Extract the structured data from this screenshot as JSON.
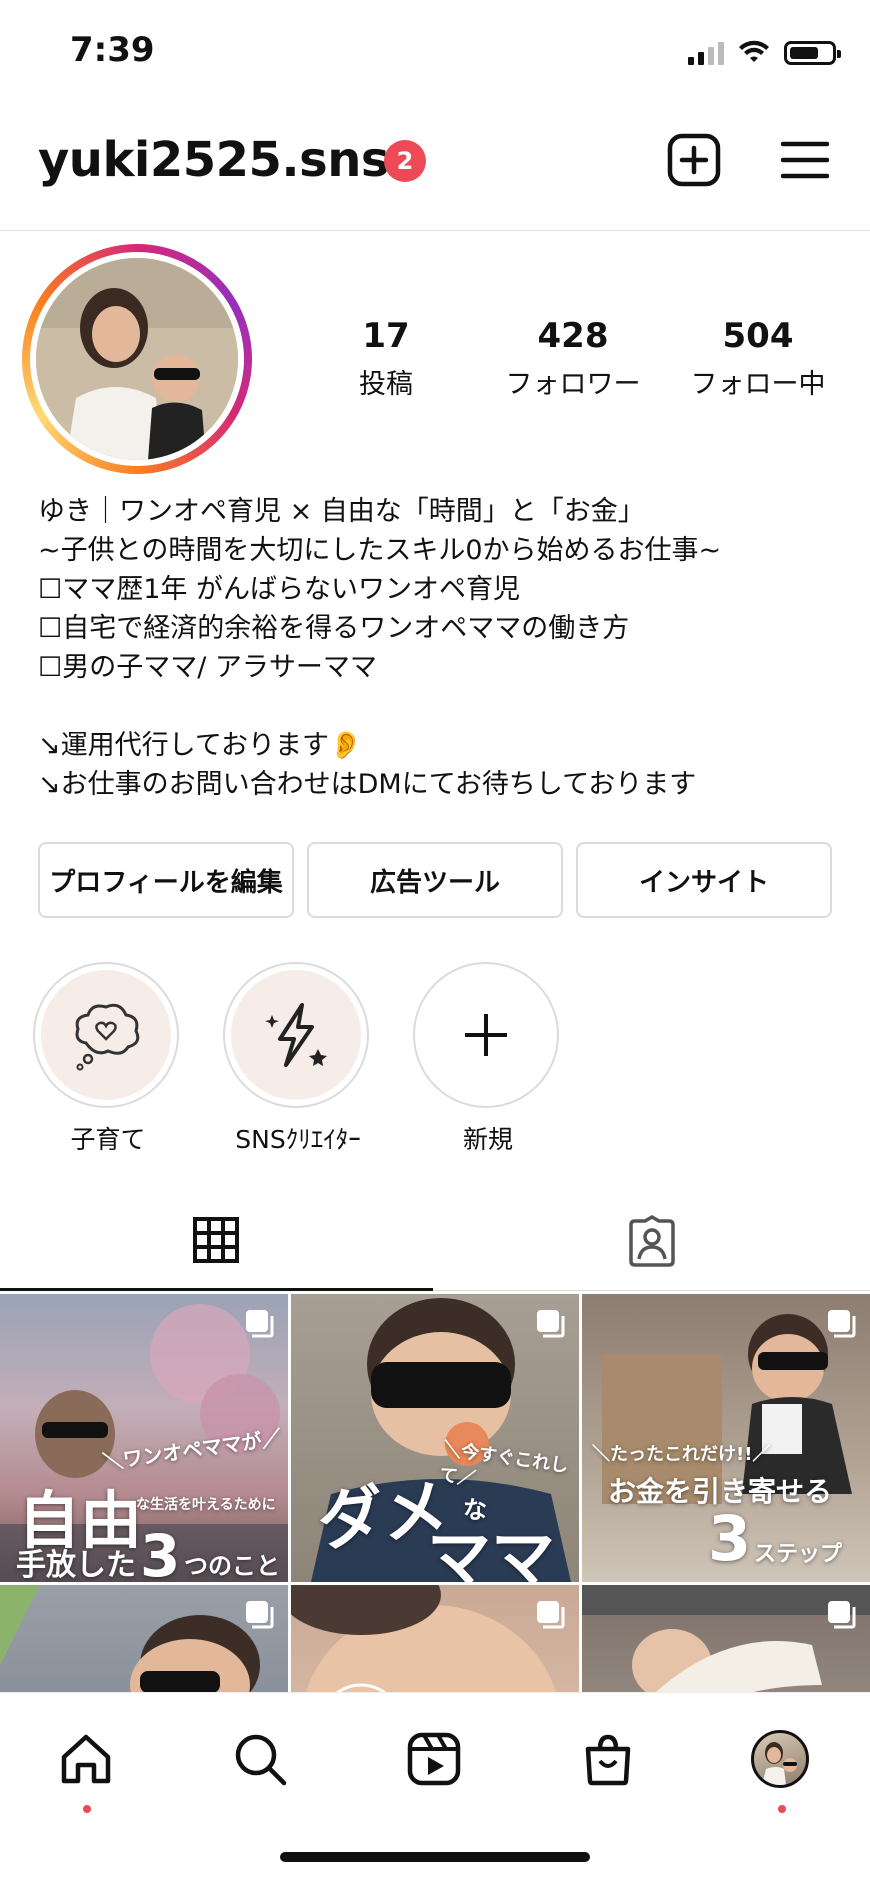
{
  "status_bar": {
    "time": "7:39"
  },
  "header": {
    "username": "yuki2525.sns",
    "notification_count": "2"
  },
  "stats": [
    {
      "value": "17",
      "label": "投稿"
    },
    {
      "value": "428",
      "label": "フォロワー"
    },
    {
      "value": "504",
      "label": "フォロー中"
    }
  ],
  "bio": {
    "lines": [
      "ゆき｜ワンオペ育児 × 自由な「時間」と「お金」",
      "~子供との時間を大切にしたスキル0から始めるお仕事~",
      "☐ママ歴1年 がんばらないワンオペ育児",
      "☐自宅で経済的余裕を得るワンオペママの働き方",
      "☐男の子ママ/ アラサーママ",
      "",
      "↘運用代行しております👂",
      "↘お仕事のお問い合わせはDMにてお待ちしております"
    ]
  },
  "actions": {
    "edit_profile": "プロフィールを編集",
    "ad_tools": "広告ツール",
    "insights": "インサイト"
  },
  "highlights": [
    {
      "label": "子育て",
      "icon": "thought-heart-icon"
    },
    {
      "label": "SNSｸﾘｴｲﾀｰ",
      "icon": "lightning-icon"
    },
    {
      "label": "新規",
      "icon": "plus-icon"
    }
  ],
  "tabs": [
    {
      "name": "grid",
      "icon": "grid-icon",
      "active": true
    },
    {
      "name": "tagged",
      "icon": "tagged-person-icon",
      "active": false
    }
  ],
  "posts": [
    {
      "line1": "＼ワンオペママが／",
      "line2": "自由",
      "line3": "な生活を叶えるために",
      "line4": "手放した",
      "num": "3",
      "line5": "つのこと"
    },
    {
      "line1": "＼今すぐこれして／",
      "line2": "ダメ",
      "line3": "な",
      "line4": "ママ",
      "num": "",
      "line5": ""
    },
    {
      "line1": "＼たったこれだけ!!／",
      "line2": "お金を引き寄せる",
      "line3": "",
      "line4": "",
      "num": "3",
      "line5": "ステップ"
    }
  ],
  "bottom_nav": [
    "home-icon",
    "search-icon",
    "reels-icon",
    "shop-icon",
    "profile-avatar"
  ],
  "colors": {
    "badge": "#ed4956",
    "border": "#dbdbdb"
  }
}
